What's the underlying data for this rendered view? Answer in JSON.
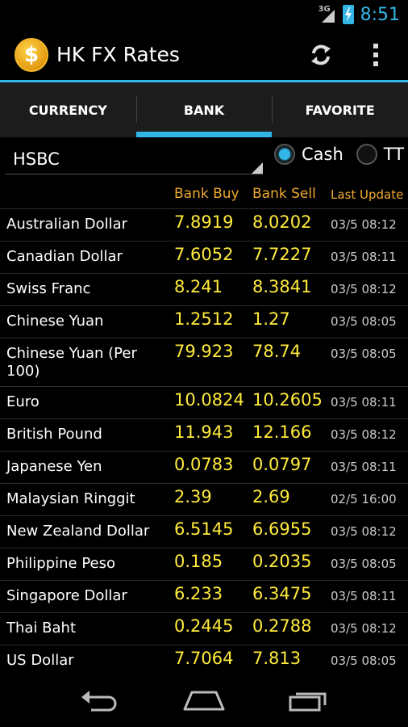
{
  "status_bar": {
    "network": "3G",
    "time": "8:51"
  },
  "action_bar": {
    "app_title": "HK FX Rates",
    "icon_symbol": "$"
  },
  "tabs": [
    {
      "label": "CURRENCY"
    },
    {
      "label": "BANK"
    },
    {
      "label": "FAVORITE"
    }
  ],
  "filter": {
    "bank_selected": "HSBC",
    "rate_type_options": [
      "Cash",
      "TT"
    ],
    "rate_type_selected": "Cash"
  },
  "table": {
    "headers": {
      "name": "",
      "buy": "Bank Buy",
      "sell": "Bank Sell",
      "updated": "Last Update"
    },
    "rows": [
      {
        "name": "Australian Dollar",
        "buy": "7.8919",
        "sell": "8.0202",
        "updated": "03/5 08:12"
      },
      {
        "name": "Canadian Dollar",
        "buy": "7.6052",
        "sell": "7.7227",
        "updated": "03/5 08:11"
      },
      {
        "name": "Swiss Franc",
        "buy": "8.241",
        "sell": "8.3841",
        "updated": "03/5 08:12"
      },
      {
        "name": "Chinese Yuan",
        "buy": "1.2512",
        "sell": "1.27",
        "updated": "03/5 08:05"
      },
      {
        "name": "Chinese Yuan (Per 100)",
        "buy": "79.923",
        "sell": "78.74",
        "updated": "03/5 08:05"
      },
      {
        "name": "Euro",
        "buy": "10.0824",
        "sell": "10.2605",
        "updated": "03/5 08:11"
      },
      {
        "name": "British Pound",
        "buy": "11.943",
        "sell": "12.166",
        "updated": "03/5 08:12"
      },
      {
        "name": "Japanese Yen",
        "buy": "0.0783",
        "sell": "0.0797",
        "updated": "03/5 08:11"
      },
      {
        "name": "Malaysian Ringgit",
        "buy": "2.39",
        "sell": "2.69",
        "updated": "02/5 16:00"
      },
      {
        "name": "New Zealand Dollar",
        "buy": "6.5145",
        "sell": "6.6955",
        "updated": "03/5 08:12"
      },
      {
        "name": "Philippine Peso",
        "buy": "0.185",
        "sell": "0.2035",
        "updated": "03/5 08:05"
      },
      {
        "name": "Singapore Dollar",
        "buy": "6.233",
        "sell": "6.3475",
        "updated": "03/5 08:11"
      },
      {
        "name": "Thai Baht",
        "buy": "0.2445",
        "sell": "0.2788",
        "updated": "03/5 08:12"
      },
      {
        "name": "US Dollar",
        "buy": "7.7064",
        "sell": "7.813",
        "updated": "03/5 08:05"
      }
    ]
  },
  "colors": {
    "accent": "#33b5e5",
    "header_text": "#f0a830",
    "value_text": "#ffeb3b"
  },
  "icons": {
    "app": "dollar-coin-icon",
    "refresh": "refresh-icon",
    "overflow": "overflow-menu-icon",
    "back": "back-icon",
    "home": "home-icon",
    "recents": "recent-apps-icon"
  }
}
